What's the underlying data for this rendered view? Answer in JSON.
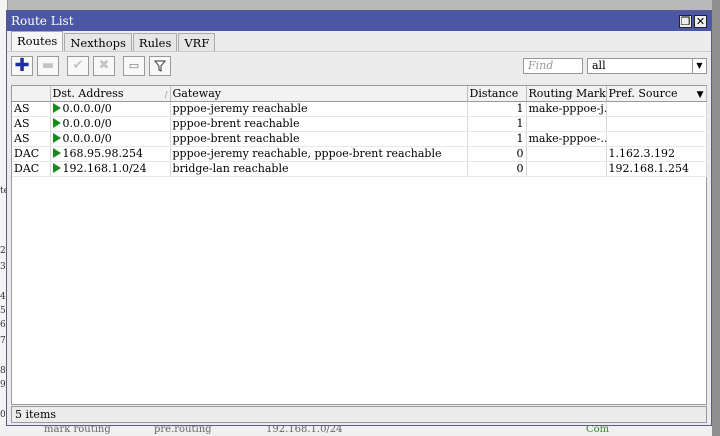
{
  "window": {
    "title": "Route List",
    "restore_glyph": "❐",
    "close_glyph": "✕"
  },
  "tabs": [
    {
      "label": "Routes",
      "active": true
    },
    {
      "label": "Nexthops"
    },
    {
      "label": "Rules"
    },
    {
      "label": "VRF"
    }
  ],
  "toolbar": {
    "add_icon": "add-icon",
    "remove_icon": "remove-icon",
    "enable_icon": "check-icon",
    "disable_icon": "x-icon",
    "comment_icon": "comment-icon",
    "filter_icon": "filter-icon",
    "find_placeholder": "Find",
    "filter_value": "all"
  },
  "table": {
    "columns": [
      "",
      "Dst. Address",
      "Gateway",
      "Distance",
      "Routing Mark",
      "Pref. Source"
    ],
    "rows": [
      {
        "flags": "AS",
        "dst": "0.0.0.0/0",
        "gateway": "pppoe-jeremy reachable",
        "distance": "1",
        "mark": "make-pppoe-j...",
        "src": ""
      },
      {
        "flags": "AS",
        "dst": "0.0.0.0/0",
        "gateway": "pppoe-brent reachable",
        "distance": "1",
        "mark": "",
        "src": ""
      },
      {
        "flags": "AS",
        "dst": "0.0.0.0/0",
        "gateway": "pppoe-brent reachable",
        "distance": "1",
        "mark": "make-pppoe-...",
        "src": ""
      },
      {
        "flags": "DAC",
        "dst": "168.95.98.254",
        "gateway": "pppoe-jeremy reachable, pppoe-brent reachable",
        "distance": "0",
        "mark": "",
        "src": "1.162.3.192"
      },
      {
        "flags": "DAC",
        "dst": "192.168.1.0/24",
        "gateway": "bridge-lan reachable",
        "distance": "0",
        "mark": "",
        "src": "192.168.1.254"
      }
    ]
  },
  "status": "5 items",
  "background": {
    "left_glyphs": [
      "te",
      "2",
      "3",
      "4",
      "5",
      "6",
      "7",
      "8",
      "9",
      "0"
    ],
    "bottom_text": [
      "mark routing",
      "pre.routing",
      "192.168.1.0/24",
      "Com"
    ]
  },
  "colors": {
    "titlebar": "#4b56a6",
    "active_flag": "#1a8a1a"
  }
}
